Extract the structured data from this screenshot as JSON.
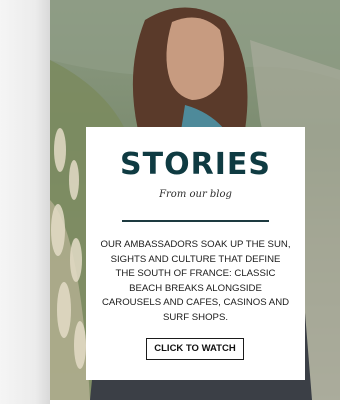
{
  "story_card": {
    "title": "STORIES",
    "subtitle": "From our blog",
    "body": "OUR AMBASSADORS SOAK UP THE SUN, SIGHTS AND CULTURE THAT DEFINE THE SOUTH OF FRANCE: CLASSIC BEACH BREAKS ALONGSIDE CAROUSELS AND CAFES, CASINOS AND SURF SHOPS.",
    "cta_label": "CLICK TO WATCH"
  },
  "colors": {
    "title": "#0f3b42",
    "card_background": "#ffffff",
    "text": "#1b1b1b"
  }
}
